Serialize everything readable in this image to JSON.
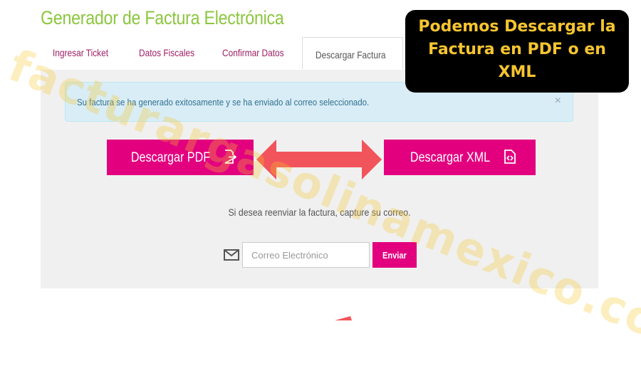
{
  "page": {
    "title": "Generador de Factura Electrónica"
  },
  "tabs": [
    {
      "label": "Ingresar Ticket",
      "active": false
    },
    {
      "label": "Datos Fiscales",
      "active": false
    },
    {
      "label": "Confirmar Datos",
      "active": false
    },
    {
      "label": "Descargar Factura",
      "active": true
    }
  ],
  "alert": {
    "message": "Su factura se ha generado exitosamente y se ha enviado al correo seleccionado.",
    "close": "×"
  },
  "actions": {
    "pdf_label": "Descargar PDF",
    "xml_label": "Descargar XML"
  },
  "resend": {
    "text": "Si desea reenviar la factura, capture su correo.",
    "email_placeholder": "Correo Electrónico",
    "email_value": "",
    "send_label": "Enviar"
  },
  "callout": {
    "line1": "Podemos Descargar la",
    "line2": "Factura en PDF o en",
    "line3": "XML"
  },
  "watermark": {
    "text": "facturargasolinamexico.com"
  },
  "colors": {
    "accent": "#e3007f",
    "title_green": "#8cc63f",
    "tab_link": "#9e1f63",
    "arrow": "#f2545b",
    "callout_bg": "#000000",
    "callout_text": "#f6c530",
    "alert_bg": "#d9edf7"
  },
  "icons": {
    "pdf": "file-export-icon",
    "xml": "file-code-icon",
    "mail": "envelope-icon",
    "arrow": "double-arrow-icon"
  }
}
